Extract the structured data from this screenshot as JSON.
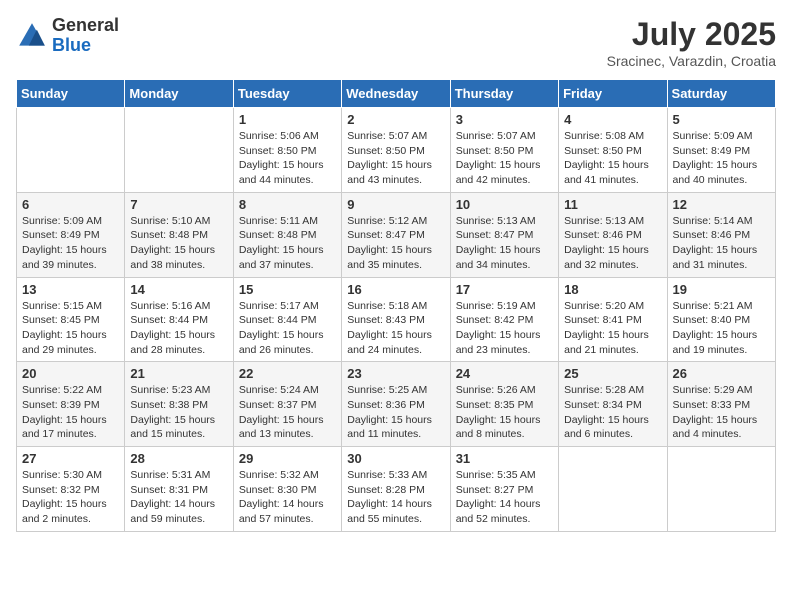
{
  "header": {
    "logo_general": "General",
    "logo_blue": "Blue",
    "month_year": "July 2025",
    "location": "Sracinec, Varazdin, Croatia"
  },
  "days_of_week": [
    "Sunday",
    "Monday",
    "Tuesday",
    "Wednesday",
    "Thursday",
    "Friday",
    "Saturday"
  ],
  "weeks": [
    [
      {
        "day": "",
        "content": ""
      },
      {
        "day": "",
        "content": ""
      },
      {
        "day": "1",
        "content": "Sunrise: 5:06 AM\nSunset: 8:50 PM\nDaylight: 15 hours and 44 minutes."
      },
      {
        "day": "2",
        "content": "Sunrise: 5:07 AM\nSunset: 8:50 PM\nDaylight: 15 hours and 43 minutes."
      },
      {
        "day": "3",
        "content": "Sunrise: 5:07 AM\nSunset: 8:50 PM\nDaylight: 15 hours and 42 minutes."
      },
      {
        "day": "4",
        "content": "Sunrise: 5:08 AM\nSunset: 8:50 PM\nDaylight: 15 hours and 41 minutes."
      },
      {
        "day": "5",
        "content": "Sunrise: 5:09 AM\nSunset: 8:49 PM\nDaylight: 15 hours and 40 minutes."
      }
    ],
    [
      {
        "day": "6",
        "content": "Sunrise: 5:09 AM\nSunset: 8:49 PM\nDaylight: 15 hours and 39 minutes."
      },
      {
        "day": "7",
        "content": "Sunrise: 5:10 AM\nSunset: 8:48 PM\nDaylight: 15 hours and 38 minutes."
      },
      {
        "day": "8",
        "content": "Sunrise: 5:11 AM\nSunset: 8:48 PM\nDaylight: 15 hours and 37 minutes."
      },
      {
        "day": "9",
        "content": "Sunrise: 5:12 AM\nSunset: 8:47 PM\nDaylight: 15 hours and 35 minutes."
      },
      {
        "day": "10",
        "content": "Sunrise: 5:13 AM\nSunset: 8:47 PM\nDaylight: 15 hours and 34 minutes."
      },
      {
        "day": "11",
        "content": "Sunrise: 5:13 AM\nSunset: 8:46 PM\nDaylight: 15 hours and 32 minutes."
      },
      {
        "day": "12",
        "content": "Sunrise: 5:14 AM\nSunset: 8:46 PM\nDaylight: 15 hours and 31 minutes."
      }
    ],
    [
      {
        "day": "13",
        "content": "Sunrise: 5:15 AM\nSunset: 8:45 PM\nDaylight: 15 hours and 29 minutes."
      },
      {
        "day": "14",
        "content": "Sunrise: 5:16 AM\nSunset: 8:44 PM\nDaylight: 15 hours and 28 minutes."
      },
      {
        "day": "15",
        "content": "Sunrise: 5:17 AM\nSunset: 8:44 PM\nDaylight: 15 hours and 26 minutes."
      },
      {
        "day": "16",
        "content": "Sunrise: 5:18 AM\nSunset: 8:43 PM\nDaylight: 15 hours and 24 minutes."
      },
      {
        "day": "17",
        "content": "Sunrise: 5:19 AM\nSunset: 8:42 PM\nDaylight: 15 hours and 23 minutes."
      },
      {
        "day": "18",
        "content": "Sunrise: 5:20 AM\nSunset: 8:41 PM\nDaylight: 15 hours and 21 minutes."
      },
      {
        "day": "19",
        "content": "Sunrise: 5:21 AM\nSunset: 8:40 PM\nDaylight: 15 hours and 19 minutes."
      }
    ],
    [
      {
        "day": "20",
        "content": "Sunrise: 5:22 AM\nSunset: 8:39 PM\nDaylight: 15 hours and 17 minutes."
      },
      {
        "day": "21",
        "content": "Sunrise: 5:23 AM\nSunset: 8:38 PM\nDaylight: 15 hours and 15 minutes."
      },
      {
        "day": "22",
        "content": "Sunrise: 5:24 AM\nSunset: 8:37 PM\nDaylight: 15 hours and 13 minutes."
      },
      {
        "day": "23",
        "content": "Sunrise: 5:25 AM\nSunset: 8:36 PM\nDaylight: 15 hours and 11 minutes."
      },
      {
        "day": "24",
        "content": "Sunrise: 5:26 AM\nSunset: 8:35 PM\nDaylight: 15 hours and 8 minutes."
      },
      {
        "day": "25",
        "content": "Sunrise: 5:28 AM\nSunset: 8:34 PM\nDaylight: 15 hours and 6 minutes."
      },
      {
        "day": "26",
        "content": "Sunrise: 5:29 AM\nSunset: 8:33 PM\nDaylight: 15 hours and 4 minutes."
      }
    ],
    [
      {
        "day": "27",
        "content": "Sunrise: 5:30 AM\nSunset: 8:32 PM\nDaylight: 15 hours and 2 minutes."
      },
      {
        "day": "28",
        "content": "Sunrise: 5:31 AM\nSunset: 8:31 PM\nDaylight: 14 hours and 59 minutes."
      },
      {
        "day": "29",
        "content": "Sunrise: 5:32 AM\nSunset: 8:30 PM\nDaylight: 14 hours and 57 minutes."
      },
      {
        "day": "30",
        "content": "Sunrise: 5:33 AM\nSunset: 8:28 PM\nDaylight: 14 hours and 55 minutes."
      },
      {
        "day": "31",
        "content": "Sunrise: 5:35 AM\nSunset: 8:27 PM\nDaylight: 14 hours and 52 minutes."
      },
      {
        "day": "",
        "content": ""
      },
      {
        "day": "",
        "content": ""
      }
    ]
  ]
}
